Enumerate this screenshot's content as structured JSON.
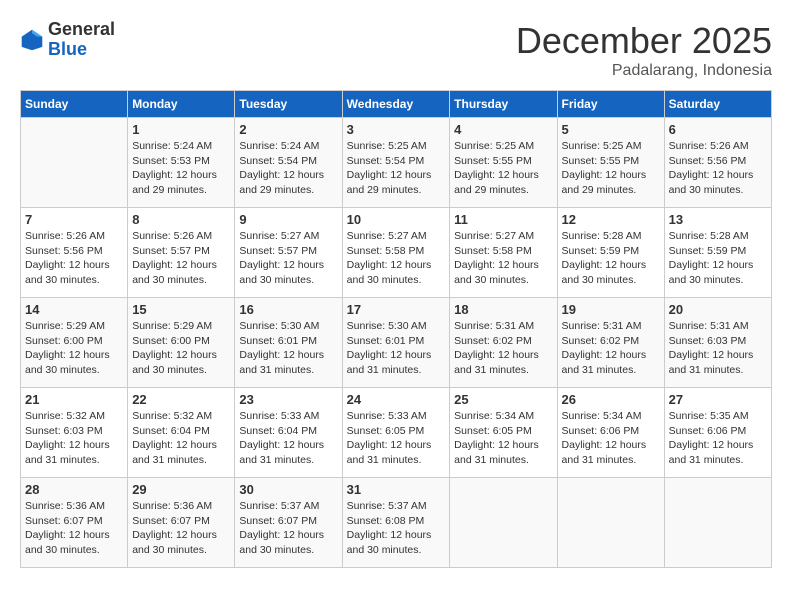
{
  "header": {
    "logo_general": "General",
    "logo_blue": "Blue",
    "month": "December 2025",
    "location": "Padalarang, Indonesia"
  },
  "weekdays": [
    "Sunday",
    "Monday",
    "Tuesday",
    "Wednesday",
    "Thursday",
    "Friday",
    "Saturday"
  ],
  "weeks": [
    [
      {
        "day": "",
        "info": ""
      },
      {
        "day": "1",
        "info": "Sunrise: 5:24 AM\nSunset: 5:53 PM\nDaylight: 12 hours\nand 29 minutes."
      },
      {
        "day": "2",
        "info": "Sunrise: 5:24 AM\nSunset: 5:54 PM\nDaylight: 12 hours\nand 29 minutes."
      },
      {
        "day": "3",
        "info": "Sunrise: 5:25 AM\nSunset: 5:54 PM\nDaylight: 12 hours\nand 29 minutes."
      },
      {
        "day": "4",
        "info": "Sunrise: 5:25 AM\nSunset: 5:55 PM\nDaylight: 12 hours\nand 29 minutes."
      },
      {
        "day": "5",
        "info": "Sunrise: 5:25 AM\nSunset: 5:55 PM\nDaylight: 12 hours\nand 29 minutes."
      },
      {
        "day": "6",
        "info": "Sunrise: 5:26 AM\nSunset: 5:56 PM\nDaylight: 12 hours\nand 30 minutes."
      }
    ],
    [
      {
        "day": "7",
        "info": "Sunrise: 5:26 AM\nSunset: 5:56 PM\nDaylight: 12 hours\nand 30 minutes."
      },
      {
        "day": "8",
        "info": "Sunrise: 5:26 AM\nSunset: 5:57 PM\nDaylight: 12 hours\nand 30 minutes."
      },
      {
        "day": "9",
        "info": "Sunrise: 5:27 AM\nSunset: 5:57 PM\nDaylight: 12 hours\nand 30 minutes."
      },
      {
        "day": "10",
        "info": "Sunrise: 5:27 AM\nSunset: 5:58 PM\nDaylight: 12 hours\nand 30 minutes."
      },
      {
        "day": "11",
        "info": "Sunrise: 5:27 AM\nSunset: 5:58 PM\nDaylight: 12 hours\nand 30 minutes."
      },
      {
        "day": "12",
        "info": "Sunrise: 5:28 AM\nSunset: 5:59 PM\nDaylight: 12 hours\nand 30 minutes."
      },
      {
        "day": "13",
        "info": "Sunrise: 5:28 AM\nSunset: 5:59 PM\nDaylight: 12 hours\nand 30 minutes."
      }
    ],
    [
      {
        "day": "14",
        "info": "Sunrise: 5:29 AM\nSunset: 6:00 PM\nDaylight: 12 hours\nand 30 minutes."
      },
      {
        "day": "15",
        "info": "Sunrise: 5:29 AM\nSunset: 6:00 PM\nDaylight: 12 hours\nand 30 minutes."
      },
      {
        "day": "16",
        "info": "Sunrise: 5:30 AM\nSunset: 6:01 PM\nDaylight: 12 hours\nand 31 minutes."
      },
      {
        "day": "17",
        "info": "Sunrise: 5:30 AM\nSunset: 6:01 PM\nDaylight: 12 hours\nand 31 minutes."
      },
      {
        "day": "18",
        "info": "Sunrise: 5:31 AM\nSunset: 6:02 PM\nDaylight: 12 hours\nand 31 minutes."
      },
      {
        "day": "19",
        "info": "Sunrise: 5:31 AM\nSunset: 6:02 PM\nDaylight: 12 hours\nand 31 minutes."
      },
      {
        "day": "20",
        "info": "Sunrise: 5:31 AM\nSunset: 6:03 PM\nDaylight: 12 hours\nand 31 minutes."
      }
    ],
    [
      {
        "day": "21",
        "info": "Sunrise: 5:32 AM\nSunset: 6:03 PM\nDaylight: 12 hours\nand 31 minutes."
      },
      {
        "day": "22",
        "info": "Sunrise: 5:32 AM\nSunset: 6:04 PM\nDaylight: 12 hours\nand 31 minutes."
      },
      {
        "day": "23",
        "info": "Sunrise: 5:33 AM\nSunset: 6:04 PM\nDaylight: 12 hours\nand 31 minutes."
      },
      {
        "day": "24",
        "info": "Sunrise: 5:33 AM\nSunset: 6:05 PM\nDaylight: 12 hours\nand 31 minutes."
      },
      {
        "day": "25",
        "info": "Sunrise: 5:34 AM\nSunset: 6:05 PM\nDaylight: 12 hours\nand 31 minutes."
      },
      {
        "day": "26",
        "info": "Sunrise: 5:34 AM\nSunset: 6:06 PM\nDaylight: 12 hours\nand 31 minutes."
      },
      {
        "day": "27",
        "info": "Sunrise: 5:35 AM\nSunset: 6:06 PM\nDaylight: 12 hours\nand 31 minutes."
      }
    ],
    [
      {
        "day": "28",
        "info": "Sunrise: 5:36 AM\nSunset: 6:07 PM\nDaylight: 12 hours\nand 30 minutes."
      },
      {
        "day": "29",
        "info": "Sunrise: 5:36 AM\nSunset: 6:07 PM\nDaylight: 12 hours\nand 30 minutes."
      },
      {
        "day": "30",
        "info": "Sunrise: 5:37 AM\nSunset: 6:07 PM\nDaylight: 12 hours\nand 30 minutes."
      },
      {
        "day": "31",
        "info": "Sunrise: 5:37 AM\nSunset: 6:08 PM\nDaylight: 12 hours\nand 30 minutes."
      },
      {
        "day": "",
        "info": ""
      },
      {
        "day": "",
        "info": ""
      },
      {
        "day": "",
        "info": ""
      }
    ]
  ]
}
